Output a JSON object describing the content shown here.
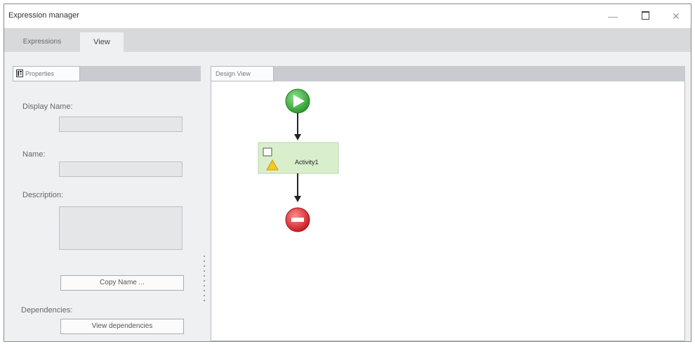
{
  "window": {
    "title": "Expression manager",
    "minimize_glyph": "—",
    "close_glyph": "✕"
  },
  "tabs": [
    {
      "label": "Expressions",
      "active": false
    },
    {
      "label": "View",
      "active": true
    }
  ],
  "properties": {
    "header": "Properties",
    "display_name_label": "Display Name:",
    "display_name_value": "",
    "name_label": "Name:",
    "name_value": "",
    "description_label": "Description:",
    "description_value": "",
    "copy_button": "Copy Name ...",
    "dependencies_label": "Dependencies:",
    "view_dependencies_button": "View dependencies"
  },
  "design": {
    "header": "Design View",
    "activity_label": "Activity1",
    "start_icon": "play-start-icon",
    "end_icon": "stop-end-icon",
    "warning_icon": "warning-icon"
  },
  "colors": {
    "start": "#3aa63a",
    "end": "#d9262b",
    "activity_bg": "#d9efcc",
    "warning": "#f3c829"
  }
}
